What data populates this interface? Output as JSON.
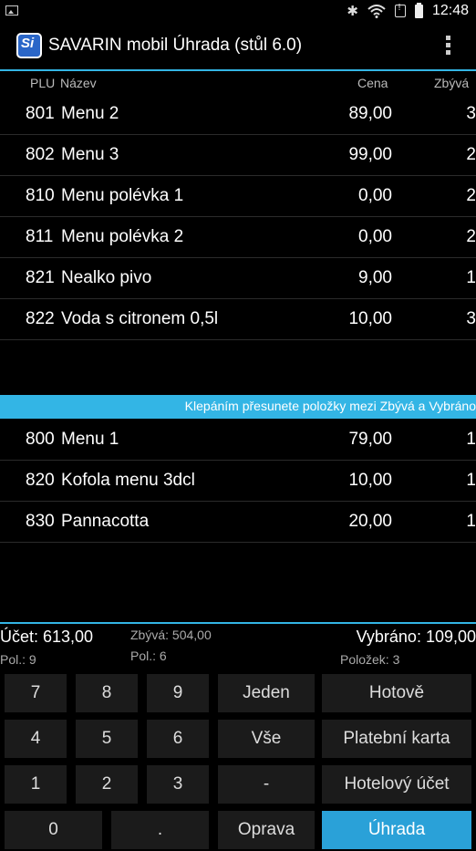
{
  "status_bar": {
    "time": "12:48",
    "icons": [
      "image-icon",
      "bluetooth-icon",
      "wifi-icon",
      "alarm-icon",
      "battery-icon"
    ]
  },
  "app_bar": {
    "title": "SAVARIN mobil Úhrada (stůl 6.0)",
    "logo_text": "Si"
  },
  "columns": {
    "plu": "PLU",
    "name": "Název",
    "price": "Cena",
    "remaining": "Zbývá"
  },
  "remaining_items": [
    {
      "plu": "801",
      "name": "Menu 2",
      "price": "89,00",
      "qty": "3"
    },
    {
      "plu": "802",
      "name": "Menu 3",
      "price": "99,00",
      "qty": "2"
    },
    {
      "plu": "810",
      "name": "Menu polévka 1",
      "price": "0,00",
      "qty": "2"
    },
    {
      "plu": "811",
      "name": "Menu polévka 2",
      "price": "0,00",
      "qty": "2"
    },
    {
      "plu": "821",
      "name": "Nealko pivo",
      "price": "9,00",
      "qty": "1"
    },
    {
      "plu": "822",
      "name": "Voda s citronem 0,5l",
      "price": "10,00",
      "qty": "3"
    }
  ],
  "hint": "Klepáním přesunete položky mezi Zbývá a Vybráno",
  "selected_items": [
    {
      "plu": "800",
      "name": "Menu 1",
      "price": "79,00",
      "qty": "1"
    },
    {
      "plu": "820",
      "name": "Kofola menu 3dcl",
      "price": "10,00",
      "qty": "1"
    },
    {
      "plu": "830",
      "name": "Pannacotta",
      "price": "20,00",
      "qty": "1"
    }
  ],
  "summary": {
    "account": "Účet: 613,00",
    "account_pol": "Pol.:  9",
    "remaining": "Zbývá: 504,00",
    "remaining_pol": "Pol.:  6",
    "selected": "Vybráno: 109,00",
    "selected_pol": "Položek:  3"
  },
  "keypad": {
    "k7": "7",
    "k8": "8",
    "k9": "9",
    "jeden": "Jeden",
    "hotove": "Hotově",
    "k4": "4",
    "k5": "5",
    "k6": "6",
    "vse": "Vše",
    "karta": "Platební karta",
    "k1": "1",
    "k2": "2",
    "k3": "3",
    "minus": "-",
    "hotel": "Hotelový účet",
    "k0": "0",
    "dot": ".",
    "oprava": "Oprava",
    "uhrada": "Úhrada"
  },
  "colors": {
    "accent": "#33b5e5",
    "primary_button": "#2aa1d8"
  }
}
